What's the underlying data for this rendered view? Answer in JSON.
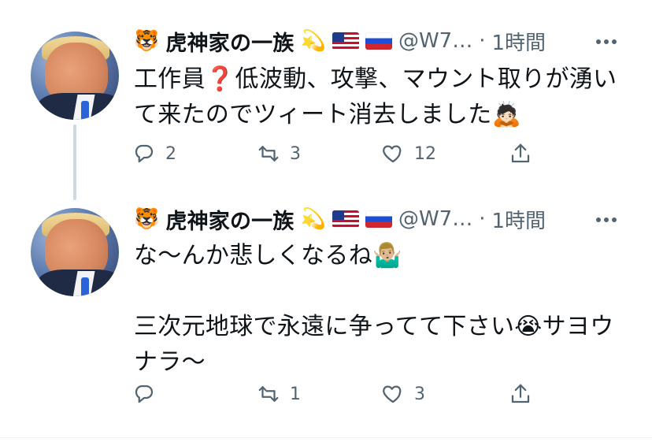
{
  "tweets": [
    {
      "author": {
        "badge_emoji": "🐯",
        "name": "虎神家の一族",
        "name_emoji": "💫",
        "handle": "@W7…",
        "separator": "·",
        "time": "1時間"
      },
      "lines": [
        "工作員❓低波動、攻撃、マウント取りが湧い",
        "て来たのでツィート消去しました🙇🏻"
      ],
      "stats": {
        "replies": "2",
        "retweets": "3",
        "likes": "12"
      }
    },
    {
      "author": {
        "badge_emoji": "🐯",
        "name": "虎神家の一族",
        "name_emoji": "💫",
        "handle": "@W7…",
        "separator": "·",
        "time": "1時間"
      },
      "lines": [
        "な〜んか悲しくなるね🤷🏼‍♂️",
        "",
        "三次元地球で永遠に争ってて下さい😭サヨウ",
        "ナラ〜"
      ],
      "stats": {
        "replies": "",
        "retweets": "1",
        "likes": "3"
      }
    }
  ],
  "icons": {
    "more": "more-horizontal-icon",
    "reply": "reply-bubble-icon",
    "retweet": "retweet-arrows-icon",
    "like": "heart-icon",
    "share": "share-upload-icon",
    "flags": [
      "us-flag-icon",
      "ru-flag-icon"
    ]
  },
  "colors": {
    "text_primary": "#0f1419",
    "text_secondary": "#536471",
    "thread_line": "#cfd9de"
  }
}
